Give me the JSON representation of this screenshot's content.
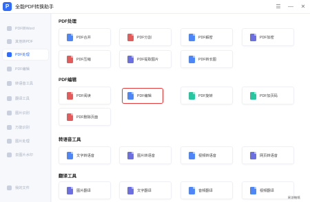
{
  "app": {
    "title": "全能PDF转换助手",
    "logo_letter": "P"
  },
  "window_controls": [
    {
      "name": "hamburger-icon",
      "glyph": "☰"
    },
    {
      "name": "minimize-icon",
      "glyph": "—"
    },
    {
      "name": "close-icon",
      "glyph": "✕"
    }
  ],
  "sidebar": {
    "items": [
      {
        "label": "PDF转Word",
        "icon": "word-icon"
      },
      {
        "label": "其他转PDF",
        "icon": "convert-icon"
      },
      {
        "label": "PDF处理",
        "icon": "pdf-tool-icon",
        "active": true
      },
      {
        "label": "PDF编辑",
        "icon": "edit-icon"
      },
      {
        "label": "转语音工具",
        "icon": "voice-icon"
      },
      {
        "label": "翻译工具",
        "icon": "translate-icon"
      },
      {
        "label": "图片识别",
        "icon": "ocr-icon"
      },
      {
        "label": "万能识别",
        "icon": "scan-icon"
      },
      {
        "label": "图片处理",
        "icon": "image-icon"
      },
      {
        "label": "去图片水印",
        "icon": "watermark-icon"
      },
      {
        "label": "我的文件",
        "icon": "folder-icon"
      }
    ]
  },
  "colors": {
    "accent": "#2f6bff",
    "red": "#e45b5b",
    "blue": "#4f86f7",
    "purple": "#6b6fe0",
    "green": "#27c5a0",
    "highlight_border": "#e23b3b"
  },
  "sections": [
    {
      "title": "PDF处理",
      "items": [
        {
          "label": "PDF合并",
          "icon": "merge-icon",
          "color": "#4f86f7"
        },
        {
          "label": "PDF分割",
          "icon": "split-icon",
          "color": "#e45b5b"
        },
        {
          "label": "PDF解密",
          "icon": "unlock-icon",
          "color": "#4f86f7"
        },
        {
          "label": "PDF加密",
          "icon": "lock-icon",
          "color": "#6b6fe0"
        },
        {
          "label": "PDF压缩",
          "icon": "compress-icon",
          "color": "#e45b5b"
        },
        {
          "label": "PDF提取图片",
          "icon": "extract-image-icon",
          "color": "#6b6fe0"
        },
        {
          "label": "PDF转长图",
          "icon": "long-image-icon",
          "color": "#4f86f7"
        }
      ]
    },
    {
      "title": "PDF编辑",
      "items": [
        {
          "label": "PDF阅读",
          "icon": "read-icon",
          "color": "#e45b5b"
        },
        {
          "label": "PDF编辑",
          "icon": "edit-pdf-icon",
          "color": "#4f86f7",
          "highlight": true
        },
        {
          "label": "PDF旋转",
          "icon": "rotate-icon",
          "color": "#27c5a0"
        },
        {
          "label": "PDF加页码",
          "icon": "page-number-icon",
          "color": "#27c5a0"
        },
        {
          "label": "PDF删除页面",
          "icon": "delete-page-icon",
          "color": "#e45b5b"
        }
      ]
    },
    {
      "title": "转语音工具",
      "items": [
        {
          "label": "文字转语音",
          "icon": "text-to-speech-icon",
          "color": "#4f86f7"
        },
        {
          "label": "图片转语音",
          "icon": "image-to-speech-icon",
          "color": "#6b6fe0"
        },
        {
          "label": "视频转语音",
          "icon": "video-to-speech-icon",
          "color": "#4f86f7"
        },
        {
          "label": "网页转语音",
          "icon": "web-to-speech-icon",
          "color": "#6b6fe0"
        }
      ]
    },
    {
      "title": "翻译工具",
      "items": [
        {
          "label": "图片翻译",
          "icon": "image-translate-icon",
          "color": "#6b6fe0"
        },
        {
          "label": "文字翻译",
          "icon": "text-translate-icon",
          "color": "#6b6fe0"
        },
        {
          "label": "音频翻译",
          "icon": "audio-translate-icon",
          "color": "#4f86f7"
        },
        {
          "label": "视频翻译",
          "icon": "video-translate-icon",
          "color": "#4f86f7"
        }
      ]
    }
  ],
  "watermark": "采访抽纸"
}
